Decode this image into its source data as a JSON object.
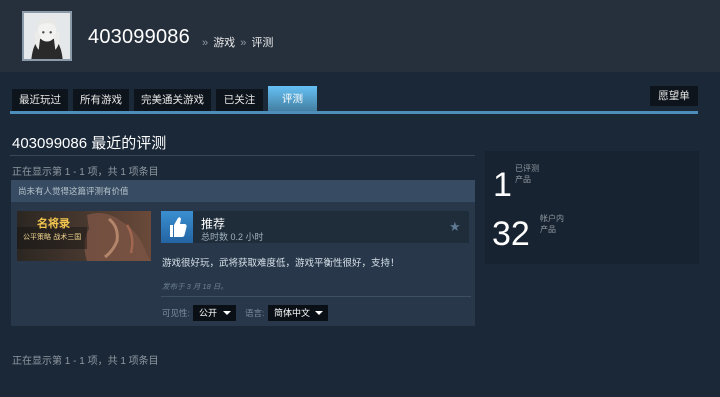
{
  "profile": {
    "name": "403099086",
    "breadcrumb": [
      {
        "label": "游戏"
      },
      {
        "label": "评测"
      }
    ],
    "breadcrumb_separator": "»"
  },
  "tabs": [
    {
      "label": "最近玩过"
    },
    {
      "label": "所有游戏"
    },
    {
      "label": "完美通关游戏"
    },
    {
      "label": "已关注"
    },
    {
      "label": "评测"
    }
  ],
  "active_tab": "评测",
  "wishlist_label": "愿望单",
  "page": {
    "title": "403099086 最近的评测",
    "showing_top": "正在显示第 1 - 1 项，共 1 项条目",
    "showing_bottom": "正在显示第 1 - 1 项，共 1 项条目"
  },
  "review": {
    "header": "尚未有人觉得这篇评测有价值",
    "game_logo_text": "名将录",
    "game_subtitle": "公平策略 战术三国",
    "recommendation": "推荐",
    "hours": "总时数 0.2 小时",
    "text": "游戏很好玩，武将获取难度低，游戏平衡性很好，支持！",
    "posted": "发布于 3 月 18 日。",
    "visibility_label": "可见性:",
    "visibility_value": "公开",
    "language_label": "语言:",
    "language_value": "简体中文",
    "icons": {
      "thumb": "thumbs-up-icon",
      "star": "star-icon"
    }
  },
  "stats": {
    "reviewed_count": "1",
    "reviewed_label_line1": "已评测",
    "reviewed_label_line2": "产品",
    "account_count": "32",
    "account_label_line1": "帐户内",
    "account_label_line2": "产品"
  },
  "colors": {
    "background": "#1b2838",
    "header_bg": "#26303d",
    "accent": "#66c0f4",
    "tab_active": "#4c8db9",
    "card_bg": "#28384a"
  }
}
